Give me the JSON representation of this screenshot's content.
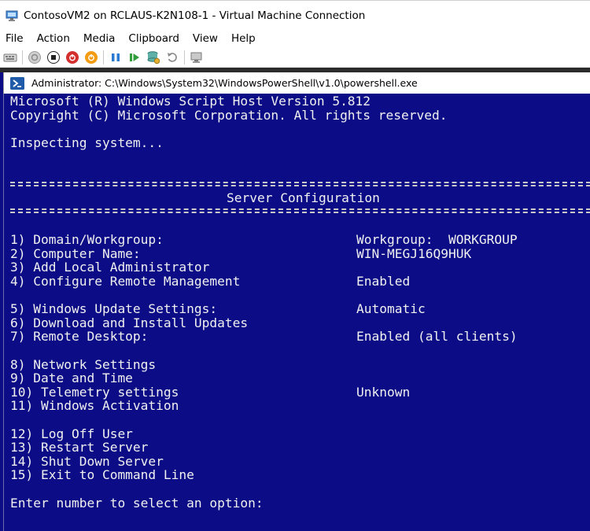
{
  "window": {
    "title": "ContosoVM2 on RCLAUS-K2N108-1 - Virtual Machine Connection"
  },
  "menu": [
    "File",
    "Action",
    "Media",
    "Clipboard",
    "View",
    "Help"
  ],
  "toolbar": {
    "icons": [
      "ctrl-alt-del-icon",
      "start-icon",
      "turn-off-icon",
      "shut-down-icon",
      "save-icon",
      "pause-icon",
      "resume-icon",
      "checkpoint-icon",
      "revert-icon",
      "enhanced-session-icon"
    ],
    "colors": {
      "turn_off": "#d32f2f",
      "shut_down": "#d32f2f",
      "save": "#f39c12",
      "pause": "#2a7ad2",
      "resume": "#2e9d3a"
    }
  },
  "powershell": {
    "title": "Administrator: C:\\Windows\\System32\\WindowsPowerShell\\v1.0\\powershell.exe"
  },
  "console": {
    "header": [
      "Microsoft (R) Windows Script Host Version 5.812",
      "Copyright (C) Microsoft Corporation. All rights reserved."
    ],
    "inspecting": "Inspecting system...",
    "section_title": "Server Configuration",
    "options": [
      {
        "label": "1) Domain/Workgroup:",
        "value": "Workgroup:  WORKGROUP"
      },
      {
        "label": "2) Computer Name:",
        "value": "WIN-MEGJ16Q9HUK"
      },
      {
        "label": "3) Add Local Administrator",
        "value": ""
      },
      {
        "label": "4) Configure Remote Management",
        "value": "Enabled"
      },
      {
        "label": "5) Windows Update Settings:",
        "value": "Automatic"
      },
      {
        "label": "6) Download and Install Updates",
        "value": ""
      },
      {
        "label": "7) Remote Desktop:",
        "value": "Enabled (all clients)"
      },
      {
        "label": "8) Network Settings",
        "value": ""
      },
      {
        "label": "9) Date and Time",
        "value": ""
      },
      {
        "label": "10) Telemetry settings",
        "value": "Unknown"
      },
      {
        "label": "11) Windows Activation",
        "value": ""
      },
      {
        "label": "12) Log Off User",
        "value": ""
      },
      {
        "label": "13) Restart Server",
        "value": ""
      },
      {
        "label": "14) Shut Down Server",
        "value": ""
      },
      {
        "label": "15) Exit to Command Line",
        "value": ""
      }
    ],
    "prompt": "Enter number to select an option:",
    "colors": {
      "background": "#0c0c86",
      "text": "#f0f0f0"
    }
  }
}
